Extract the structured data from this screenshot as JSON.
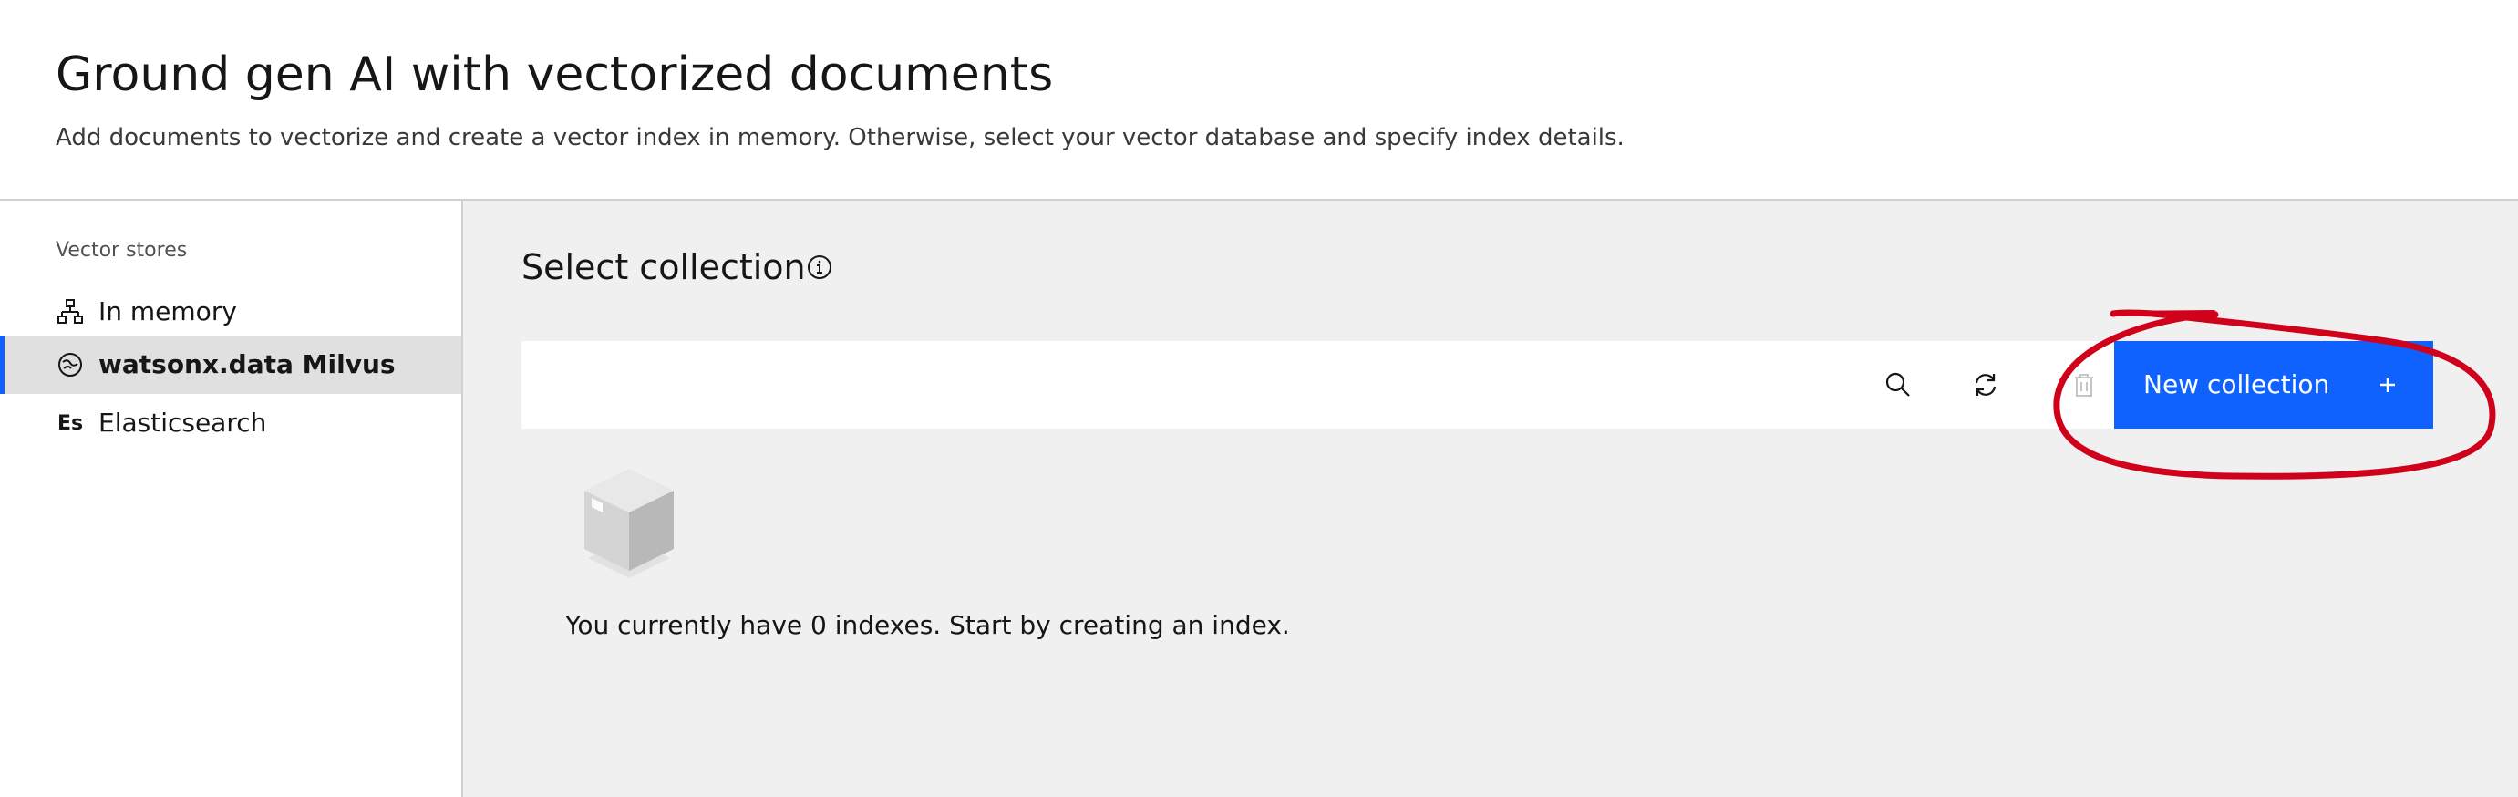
{
  "header": {
    "title": "Ground gen AI with vectorized documents",
    "subtitle": "Add documents to vectorize and create a vector index in memory. Otherwise, select your vector database and specify index details."
  },
  "sidebar": {
    "heading": "Vector stores",
    "items": [
      {
        "label": "In memory",
        "icon": "memory-icon",
        "active": false
      },
      {
        "label": "watsonx.data Milvus",
        "icon": "milvus-icon",
        "active": true
      },
      {
        "label": "Elasticsearch",
        "icon": "elasticsearch-icon",
        "glyph": "Es",
        "active": false
      }
    ]
  },
  "main": {
    "title": "Select collection",
    "toolbar": {
      "icons": [
        "search-icon",
        "refresh-icon",
        "trash-icon"
      ],
      "new_button_label": "New collection"
    },
    "empty_state": {
      "icon": "box-icon",
      "text": "You currently have 0 indexes. Start by creating an index."
    }
  },
  "colors": {
    "accent": "#0f62fe",
    "annotation": "#d0021b",
    "main_bg": "#f0f0f0"
  }
}
